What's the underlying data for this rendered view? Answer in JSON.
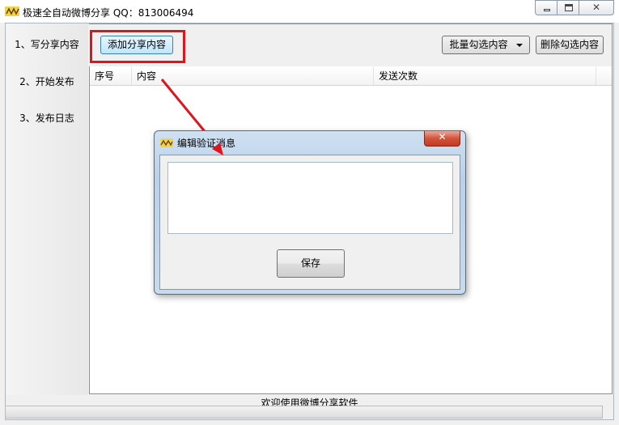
{
  "window": {
    "title": "极速全自动微博分享 QQ：813006494",
    "icon": "app-logo-icon",
    "controls": {
      "minimize": "minimize-icon",
      "maximize": "maximize-icon",
      "close": "close-icon"
    }
  },
  "sidebar": {
    "items": [
      {
        "label": "1、写分享内容"
      },
      {
        "label": "2、开始发布"
      },
      {
        "label": "3、发布日志"
      }
    ]
  },
  "toolbar": {
    "add_label": "添加分享内容",
    "batch_select_label": "批量勾选内容",
    "delete_selected_label": "删除勾选内容"
  },
  "table": {
    "columns": [
      "序号",
      "内容",
      "发送次数"
    ],
    "rows": []
  },
  "status": {
    "text": "欢迎使用微博分享软件",
    "progress": 0
  },
  "dialog": {
    "title": "编辑验证消息",
    "textarea_value": "",
    "save_label": "保存"
  },
  "colors": {
    "highlight_red": "#e0141b",
    "arrow_red": "#e0141b",
    "dialog_frame": "#b9d1ea"
  }
}
